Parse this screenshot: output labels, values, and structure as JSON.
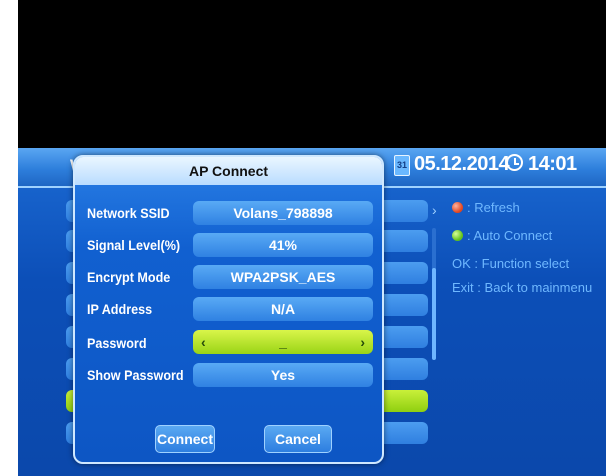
{
  "header": {
    "title": "W",
    "date": "05.12.2014",
    "time": "14:01",
    "calendar_icon_text": "31"
  },
  "help": {
    "items": [
      {
        "key": "red-dot-icon",
        "label": ": Refresh"
      },
      {
        "key": "green-dot-icon",
        "label": ": Auto Connect"
      },
      {
        "key": "OK",
        "label": ": Function select"
      },
      {
        "key": "Exit",
        "label": ": Back to mainmenu"
      }
    ]
  },
  "dialog": {
    "title": "AP Connect",
    "rows": [
      {
        "label": "Network SSID",
        "value": "Volans_798898"
      },
      {
        "label": "Signal Level(%)",
        "value": "41%"
      },
      {
        "label": "Encrypt Mode",
        "value": "WPA2PSK_AES"
      },
      {
        "label": "IP Address",
        "value": "N/A"
      },
      {
        "label": "Password",
        "value": "_"
      },
      {
        "label": "Show Password",
        "value": "Yes"
      }
    ],
    "connect_label": "Connect",
    "cancel_label": "Cancel"
  },
  "colors": {
    "accent": "#1c6bd4",
    "highlight": "#b4e82a"
  }
}
